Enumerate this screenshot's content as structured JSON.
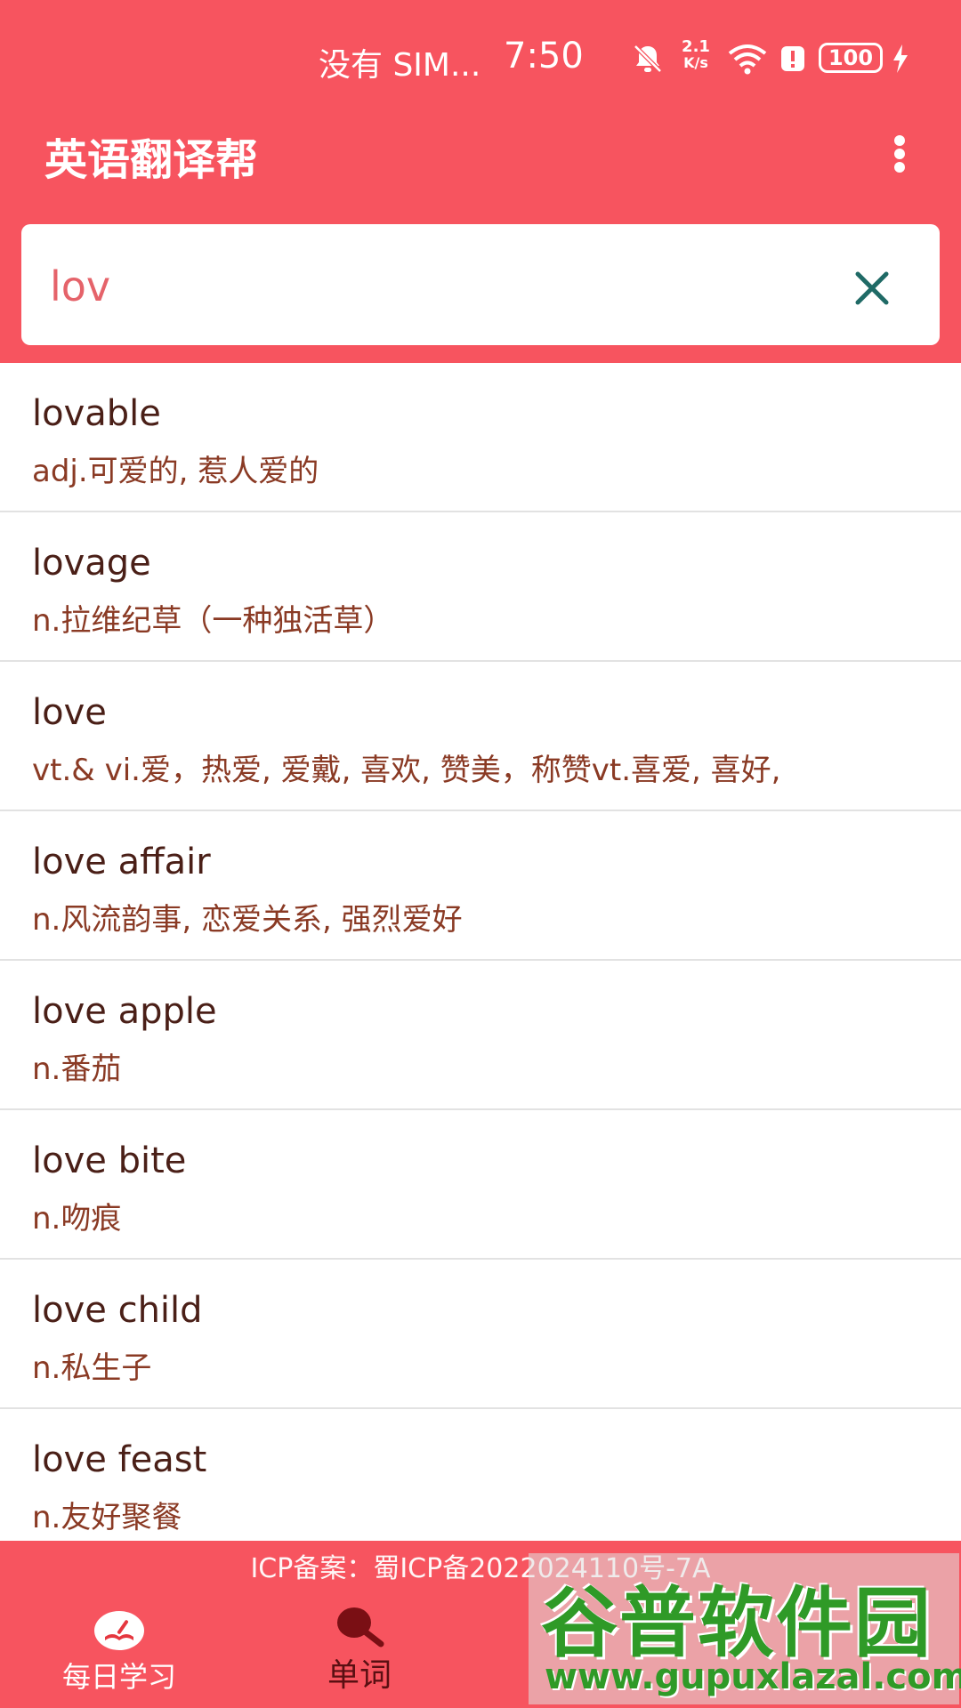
{
  "status_bar": {
    "carrier": "没有 SIM...",
    "time": "7:50",
    "net_speed_top": "2.1",
    "net_speed_bottom": "K/s",
    "battery": "100"
  },
  "app_bar": {
    "title": "英语翻译帮",
    "menu_icon": "more-vert-icon"
  },
  "search": {
    "value": "lov",
    "clear_icon": "close-icon"
  },
  "results": [
    {
      "word": "lovable",
      "definition": "adj.可爱的, 惹人爱的"
    },
    {
      "word": "lovage",
      "definition": "n.拉维纪草（一种独活草）"
    },
    {
      "word": "love",
      "definition": "vt.& vi.爱，热爱, 爱戴, 喜欢, 赞美，称赞vt.喜爱, 喜好,"
    },
    {
      "word": "love affair",
      "definition": "n.风流韵事, 恋爱关系, 强烈爱好"
    },
    {
      "word": "love apple",
      "definition": "n.番茄"
    },
    {
      "word": "love bite",
      "definition": "n.吻痕"
    },
    {
      "word": "love child",
      "definition": "n.私生子"
    },
    {
      "word": "love feast",
      "definition": "n.友好聚餐"
    }
  ],
  "footer": {
    "icp": "ICP备案：蜀ICP备2022024110号-7A"
  },
  "bottom_nav": [
    {
      "label": "每日学习",
      "icon": "book-icon",
      "selected": false
    },
    {
      "label": "单词",
      "icon": "search-icon",
      "selected": true
    }
  ],
  "watermark": {
    "site_name": "谷普软件园",
    "url": "www.gupuxlazal.com"
  },
  "colors": {
    "primary": "#f7545f",
    "search_text": "#e5636a",
    "word_text": "#4a1f17",
    "definition_text": "#8a3a24",
    "clear_icon": "#1f6a66",
    "watermark_green": "#2f9a27"
  }
}
